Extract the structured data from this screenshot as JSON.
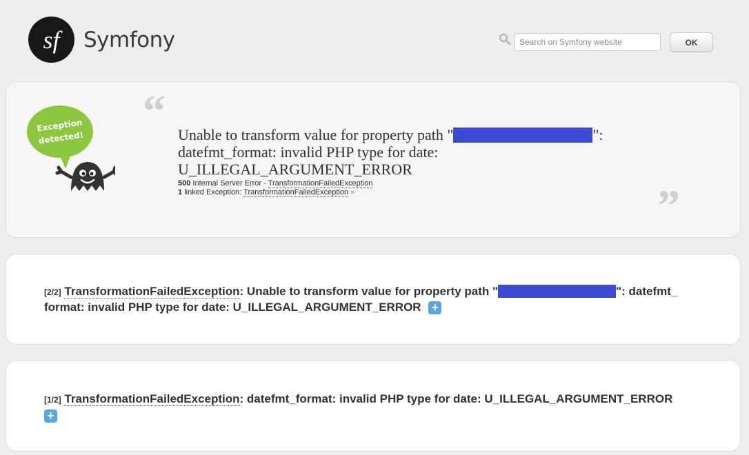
{
  "header": {
    "brand": "Symfony",
    "search_placeholder": "Search on Symfony website",
    "ok_label": "OK"
  },
  "hero": {
    "badge_text": "Exception detected!",
    "message_line1_before": "Unable to transform value for property path \"",
    "message_line1_after": "\":",
    "message_line2": "datefmt_format: invalid PHP type for date:",
    "message_line3": "U_ILLEGAL_ARGUMENT_ERROR",
    "status_code": "500",
    "status_text": "Internal Server Error -",
    "exception_class": "TransformationFailedException",
    "linked_count": "1",
    "linked_text": "linked Exception:",
    "linked_class": "TransformationFailedException",
    "raquo": "»",
    "quote_open": "“",
    "quote_close": "”"
  },
  "traces": [
    {
      "counter": "[2/2]",
      "class": "TransformationFailedException",
      "message_before": ": Unable to transform value for property path \"",
      "message_after": "\": datefmt_ format: invalid PHP type for date: U_ILLEGAL_ARGUMENT_ERROR",
      "toggle": "+"
    },
    {
      "counter": "[1/2]",
      "class": "TransformationFailedException",
      "message": ": datefmt_format: invalid PHP type for date: U_ILLEGAL_ARGUMENT_ERROR",
      "toggle": "+"
    }
  ],
  "colors": {
    "redaction": "#3c4bd6",
    "toggle": "#55a7e0",
    "badge": "#8dc63f"
  }
}
